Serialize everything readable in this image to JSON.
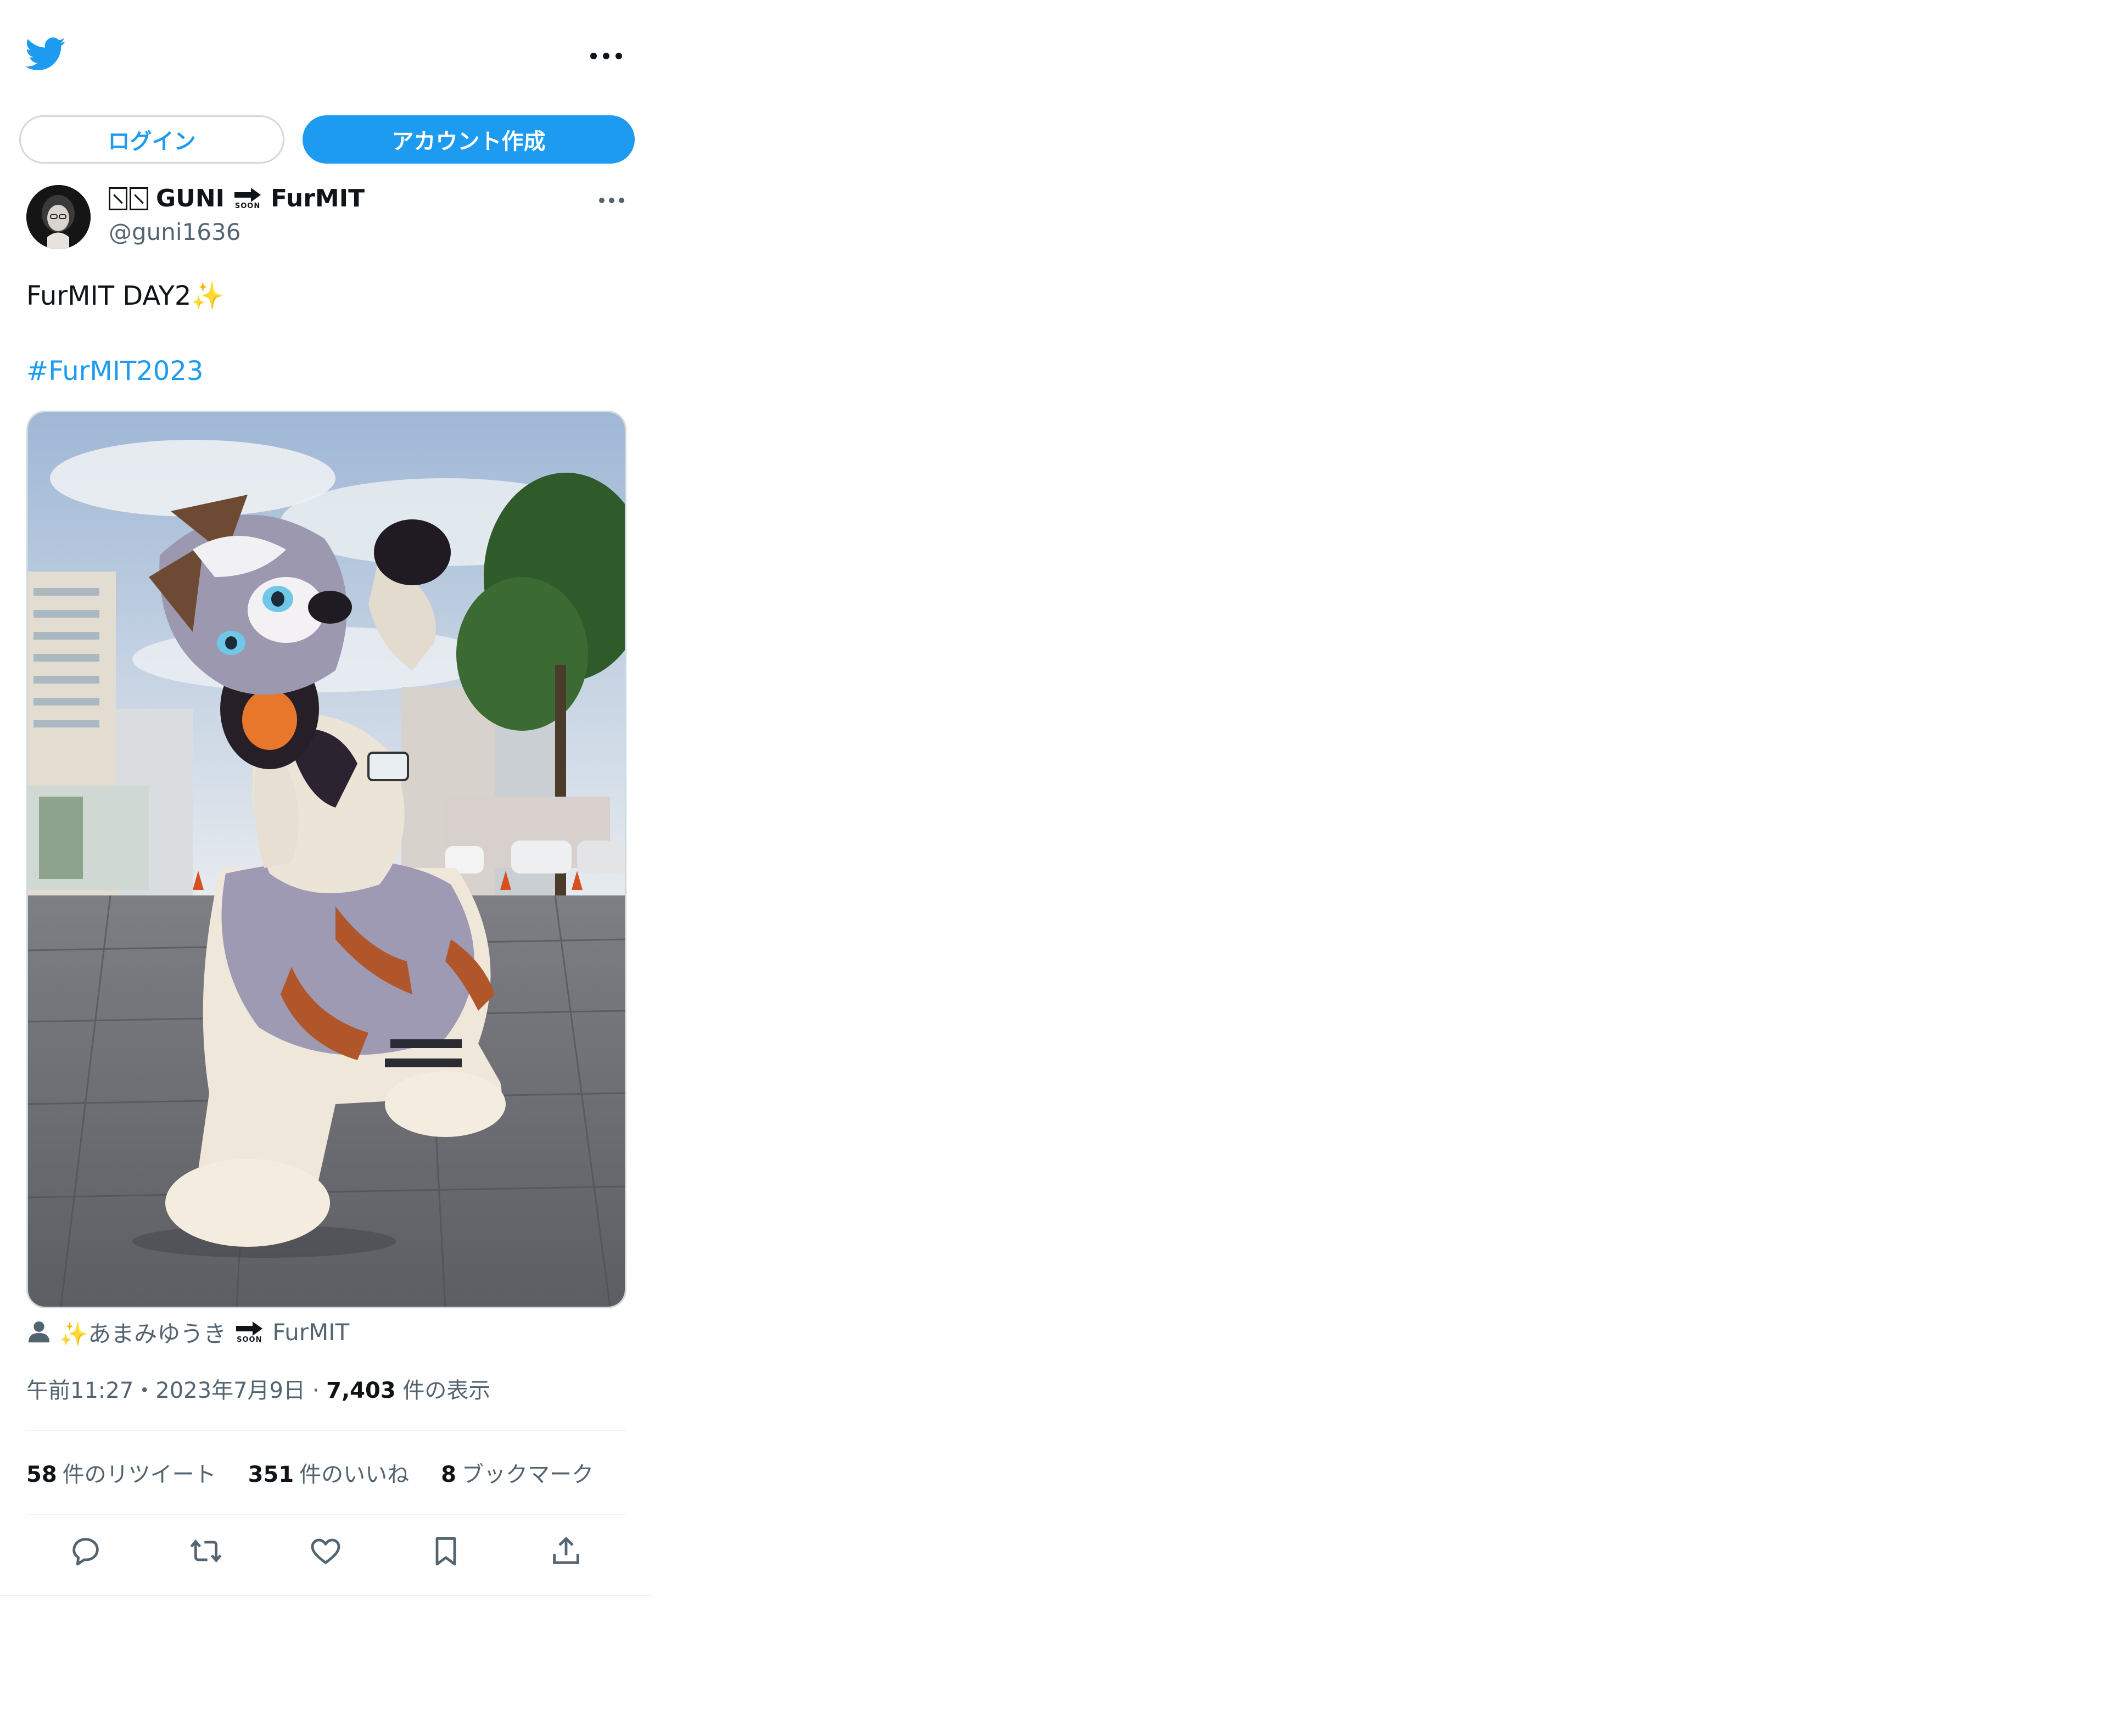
{
  "header": {
    "logo_icon": "twitter-bird-icon",
    "more_icon": "more-horizontal-icon"
  },
  "auth": {
    "login_label": "ログイン",
    "signup_label": "アカウント作成"
  },
  "tweet": {
    "author": {
      "name_prefix_glyphs": "☒☒",
      "name_start": "GUNI",
      "soon_label": "SOON",
      "name_end": "FurMIT",
      "handle": "@guni1636"
    },
    "text": "FurMIT DAY2✨",
    "hashtag": "#FurMIT2023",
    "tagged": {
      "icon": "person-icon",
      "prefix": "✨あまみゆうき",
      "soon_label": "SOON",
      "suffix": "FurMIT"
    },
    "meta": {
      "time": "午前11:27",
      "date": "2023年7月9日",
      "views_count": "7,403",
      "views_label": "件の表示",
      "separator": "・"
    },
    "stats": [
      {
        "count": "58",
        "label": "件のリツイート"
      },
      {
        "count": "351",
        "label": "件のいいね"
      },
      {
        "count": "8",
        "label": "ブックマーク"
      }
    ],
    "actions": [
      "reply-icon",
      "retweet-icon",
      "like-icon",
      "bookmark-icon",
      "share-icon"
    ]
  },
  "colors": {
    "accent": "#1d9bf0",
    "text": "#0f1419",
    "secondary": "#536471",
    "border": "#cfd9de"
  }
}
